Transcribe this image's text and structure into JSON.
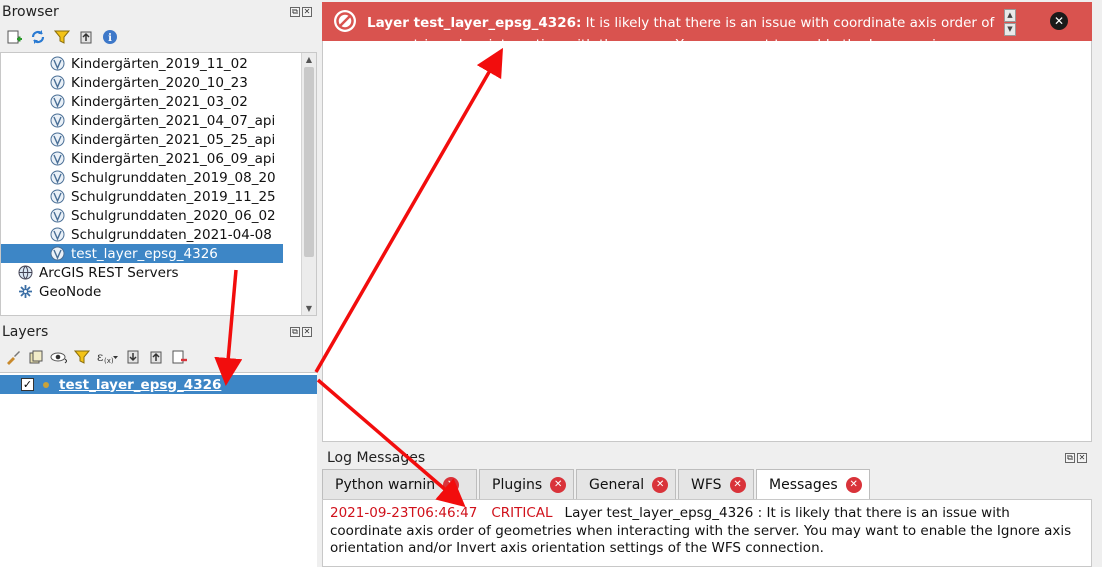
{
  "browser": {
    "title": "Browser",
    "items": [
      {
        "label": "Kindergärten_2019_11_02"
      },
      {
        "label": "Kindergärten_2020_10_23"
      },
      {
        "label": "Kindergärten_2021_03_02"
      },
      {
        "label": "Kindergärten_2021_04_07_api"
      },
      {
        "label": "Kindergärten_2021_05_25_api"
      },
      {
        "label": "Kindergärten_2021_06_09_api"
      },
      {
        "label": "Schulgrunddaten_2019_08_20"
      },
      {
        "label": "Schulgrunddaten_2019_11_25"
      },
      {
        "label": "Schulgrunddaten_2020_06_02"
      },
      {
        "label": "Schulgrunddaten_2021-04-08"
      },
      {
        "label": "test_layer_epsg_4326",
        "selected": true
      }
    ],
    "top_items": [
      {
        "label": "ArcGIS REST Servers",
        "icon": "globe-icon"
      },
      {
        "label": "GeoNode",
        "icon": "geonode-icon"
      }
    ]
  },
  "layers": {
    "title": "Layers",
    "layer_name": "test_layer_epsg_4326",
    "checked": true
  },
  "message_bar": {
    "layer_label": "Layer test_layer_epsg_4326:",
    "text": " It is likely that there is an issue with coordinate axis order of geometries when interacting with the server. You may want to enable the Ignore axis",
    "color": "#d9534f"
  },
  "log": {
    "title": "Log Messages",
    "tabs": [
      "Python warnin",
      "Plugins",
      "General",
      "WFS",
      "Messages"
    ],
    "active_tab": "Messages",
    "entry": {
      "timestamp": "2021-09-23T06:46:47",
      "level": "CRITICAL",
      "message": "Layer test_layer_epsg_4326 : It is likely that there is an issue with coordinate axis order of geometries when interacting with the server. You may want to enable the Ignore axis orientation and/or Invert axis orientation settings of the WFS connection."
    }
  },
  "colors": {
    "accent": "#3d86c6",
    "error": "#d9333a",
    "arrow": "#f20d0d"
  }
}
